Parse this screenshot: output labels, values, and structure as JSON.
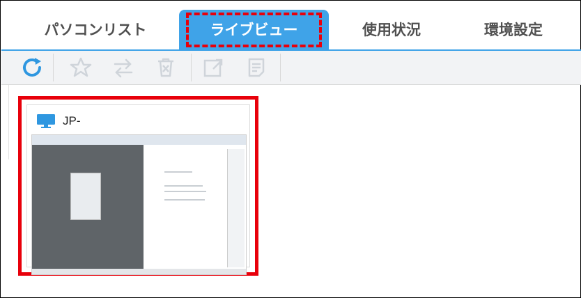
{
  "tabs": {
    "pc_list": "パソコンリスト",
    "live_view": "ライブビュー",
    "usage": "使用状況",
    "settings": "環境設定"
  },
  "toolbar": {
    "icons": [
      "refresh-icon",
      "star-icon",
      "transfer-icon",
      "delete-icon",
      "expand-icon",
      "notes-icon"
    ]
  },
  "card": {
    "pc_name": "JP-"
  },
  "colors": {
    "accent": "#3fa3e8",
    "highlight": "#e8000b"
  }
}
